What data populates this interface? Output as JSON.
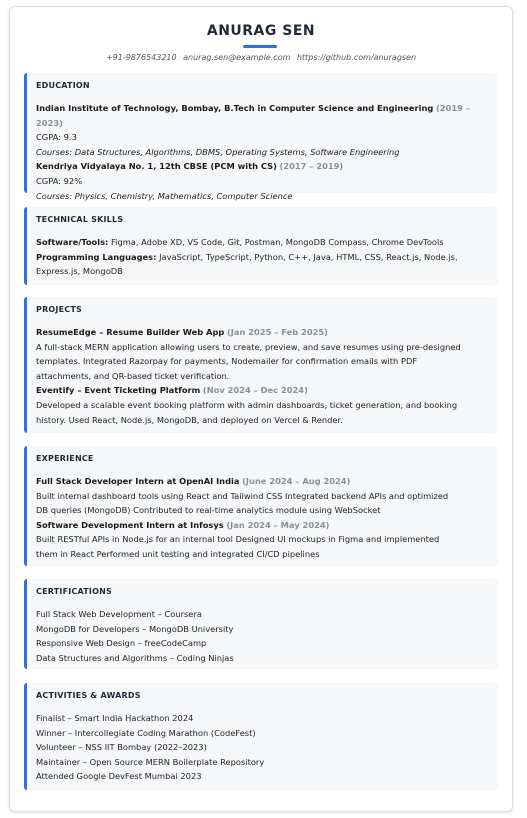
{
  "header": {
    "name": "ANURAG SEN",
    "phone": "+91-9876543210",
    "email": "anurag.sen@example.com",
    "github": "https://github.com/anuragsen"
  },
  "education": {
    "title": "EDUCATION",
    "items": [
      {
        "institution": "Indian Institute of Technology, Bombay, B.Tech in Computer Science and Engineering",
        "dates": "(2019 – 2023)",
        "grade": "CGPA: 9.3",
        "courses": "Courses: Data Structures, Algorithms, DBMS, Operating Systems, Software Engineering"
      },
      {
        "institution": "Kendriya Vidyalaya No. 1, 12th CBSE (PCM with CS)",
        "dates": "(2017 – 2019)",
        "grade": "CGPA: 92%",
        "courses": "Courses: Physics, Chemistry, Mathematics, Computer Science"
      }
    ]
  },
  "skills": {
    "title": "TECHNICAL SKILLS",
    "tools_label": "Software/Tools:",
    "tools": "Figma, Adobe XD, VS Code, Git, Postman, MongoDB Compass, Chrome DevTools",
    "langs_label": "Programming Languages:",
    "langs_line1": "JavaScript, TypeScript, Python, C++, Java, HTML, CSS, React.js, Node.js,",
    "langs_line2": "Express.js, MongoDB"
  },
  "projects": {
    "title": "PROJECTS",
    "items": [
      {
        "name": "ResumeEdge – Resume Builder Web App",
        "dates": "(Jan 2025 – Feb 2025)",
        "lines": [
          "A full-stack MERN application allowing users to create, preview, and save resumes using pre-designed",
          "templates. Integrated Razorpay for payments, Nodemailer for confirmation emails with PDF",
          "attachments, and QR-based ticket verification."
        ]
      },
      {
        "name": "Eventify – Event Ticketing Platform",
        "dates": "(Nov 2024 – Dec 2024)",
        "lines": [
          "Developed a scalable event booking platform with admin dashboards, ticket generation, and booking",
          "history. Used React, Node.js, MongoDB, and deployed on Vercel & Render."
        ]
      }
    ]
  },
  "experience": {
    "title": "EXPERIENCE",
    "items": [
      {
        "role": "Full Stack Developer Intern at OpenAI India",
        "dates": "(June 2024 – Aug 2024)",
        "lines": [
          "Built internal dashboard tools using React and Tailwind CSS Integrated backend APIs and optimized",
          "DB queries (MongoDB) Contributed to real-time analytics module using WebSocket"
        ]
      },
      {
        "role": "Software Development Intern at Infosys",
        "dates": "(Jan 2024 – May 2024)",
        "lines": [
          "Built RESTful APIs in Node.js for an internal tool Designed UI mockups in Figma and implemented",
          "them in React Performed unit testing and integrated CI/CD pipelines"
        ]
      }
    ]
  },
  "certifications": {
    "title": "CERTIFICATIONS",
    "items": [
      "Full Stack Web Development – Coursera",
      "MongoDB for Developers – MongoDB University",
      "Responsive Web Design – freeCodeCamp",
      "Data Structures and Algorithms – Coding Ninjas"
    ]
  },
  "activities": {
    "title": "ACTIVITIES & AWARDS",
    "items": [
      "Finalist – Smart India Hackathon 2024",
      "Winner – Intercollegiate Coding Marathon (CodeFest)",
      "Volunteer – NSS IIT Bombay (2022–2023)",
      "Maintainer – Open Source MERN Boilerplate Repository",
      "Attended Google DevFest Mumbai 2023"
    ]
  },
  "colors": {
    "accent": "#2f6fe0",
    "muted_dates": "#8a8f97",
    "section_bg": "#f6f7f9"
  }
}
